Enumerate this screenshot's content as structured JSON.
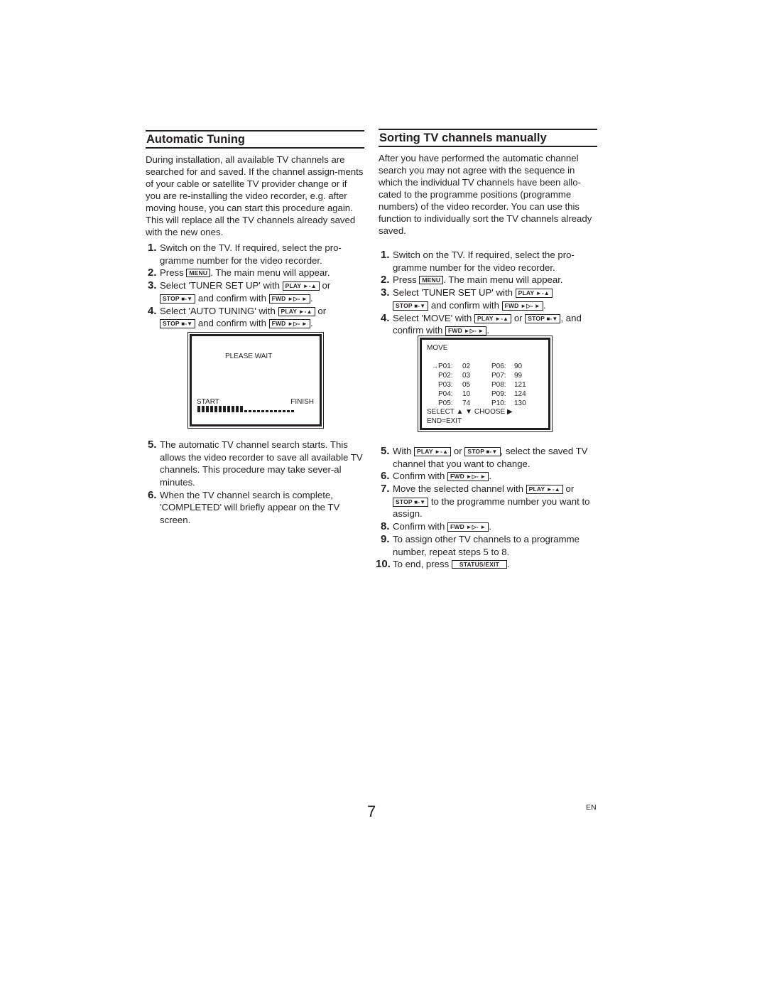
{
  "left": {
    "heading": "Automatic Tuning",
    "intro": "During installation, all available TV channels are searched for and saved. If the channel assign-ments of your cable or satellite TV provider change or if you are re-installing the video recorder, e.g. after moving house, you can start this procedure again. This will replace all the TV channels already saved with the new ones.",
    "steps": [
      {
        "num": "1.",
        "text": "Switch on the TV. If required, select the pro-gramme number for the video recorder."
      },
      {
        "num": "2.",
        "pre": "Press ",
        "key": "MENU",
        "post": ". The main menu will appear."
      },
      {
        "num": "3.",
        "pre": "Select 'TUNER SET UP' with ",
        "post_mid": " or ",
        "mid2": " and confirm with ",
        "post": "."
      },
      {
        "num": "4.",
        "pre": "Select 'AUTO TUNING' with ",
        "post_mid": " or ",
        "mid2": " and confirm with ",
        "post": "."
      },
      {
        "num": "5.",
        "text": "The automatic TV channel search starts. This allows the video recorder to save all available TV channels. This procedure may take sever-al minutes."
      },
      {
        "num": "6.",
        "text": "When the TV channel search is complete, 'COMPLETED' will briefly appear on the TV screen."
      }
    ],
    "screen": {
      "title": "PLEASE WAIT",
      "start_label": "START",
      "finish_label": "FINISH",
      "progress_filled_segments": 11,
      "progress_total_segments": 23
    }
  },
  "right": {
    "heading": "Sorting TV channels manually",
    "intro": "After you have performed the automatic channel search you may not agree with the sequence in which the individual TV channels have been allo-cated to the programme positions (programme numbers) of the video recorder. You can use this function to individually sort the TV channels already saved.",
    "steps": [
      {
        "num": "1.",
        "text": "Switch on the TV. If required, select the pro-gramme number for the video recorder."
      },
      {
        "num": "2.",
        "pre": "Press ",
        "key": "MENU",
        "post": ". The main menu will appear."
      },
      {
        "num": "3.",
        "pre": "Select 'TUNER SET UP' with ",
        "mid2": " and confirm with ",
        "post": "."
      },
      {
        "num": "4.",
        "pre": "Select 'MOVE' with ",
        "post_mid": " or ",
        "mid2": ", and confirm with ",
        "post": "."
      },
      {
        "num": "5.",
        "pre": "With ",
        "post_mid": " or ",
        "post": ", select the saved TV channel that you want to change."
      },
      {
        "num": "6.",
        "pre": "Confirm with ",
        "post": "."
      },
      {
        "num": "7.",
        "pre": "Move the selected channel with ",
        "post_mid": " or ",
        "post": " to the programme number you want to assign."
      },
      {
        "num": "8.",
        "pre": "Confirm with ",
        "post": "."
      },
      {
        "num": "9.",
        "text": "To assign other TV channels to a programme number, repeat steps 5 to 8."
      },
      {
        "num": "10.",
        "pre": "To end, press ",
        "key": "STATUS/EXIT",
        "post": "."
      }
    ],
    "screen": {
      "title": "MOVE",
      "cursor": "→",
      "rows": [
        {
          "p1": "P01:",
          "v1": "02",
          "p2": "P06:",
          "v2": "90"
        },
        {
          "p1": "P02:",
          "v1": "03",
          "p2": "P07:",
          "v2": "99"
        },
        {
          "p1": "P03:",
          "v1": "05",
          "p2": "P08:",
          "v2": "121"
        },
        {
          "p1": "P04:",
          "v1": "10",
          "p2": "P09:",
          "v2": "124"
        },
        {
          "p1": "P05:",
          "v1": "74",
          "p2": "P10:",
          "v2": "130"
        }
      ],
      "hint": "SELECT ▲ ▼  CHOOSE ▶",
      "exit": "END=EXIT"
    }
  },
  "keys": {
    "play": "PLAY",
    "play_glyph": "►-▲",
    "stop": "STOP",
    "stop_glyph": "■-▼",
    "fwd": "FWD",
    "fwd_glyph": "►▷- ►"
  },
  "footer": {
    "page_number": "7",
    "language": "EN"
  }
}
